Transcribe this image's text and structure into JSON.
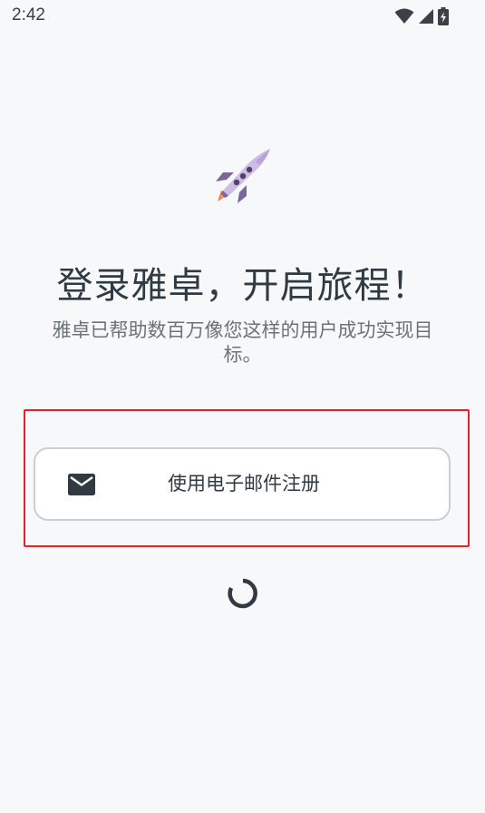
{
  "status_bar": {
    "time": "2:42",
    "icons": [
      "wifi-icon",
      "cellular-signal-icon",
      "battery-charging-icon"
    ]
  },
  "hero": {
    "icon": "rocket-icon",
    "title": "登录雅卓，开启旅程！",
    "subtitle": "雅卓已帮助数百万像您这样的用户成功实现目标。"
  },
  "signup": {
    "email_button_label": "使用电子邮件注册",
    "email_icon": "mail-icon",
    "highlight_color": "#e0242a"
  },
  "loading": {
    "icon": "loading-spinner-icon"
  },
  "colors": {
    "background": "#f7f8fa",
    "text_primary": "#2f3a43",
    "text_secondary": "#6b7378",
    "button_border": "#cbced2",
    "rocket_body": "#cdbde6",
    "rocket_accent": "#7a679e",
    "rocket_flame": "#f07a4a"
  }
}
